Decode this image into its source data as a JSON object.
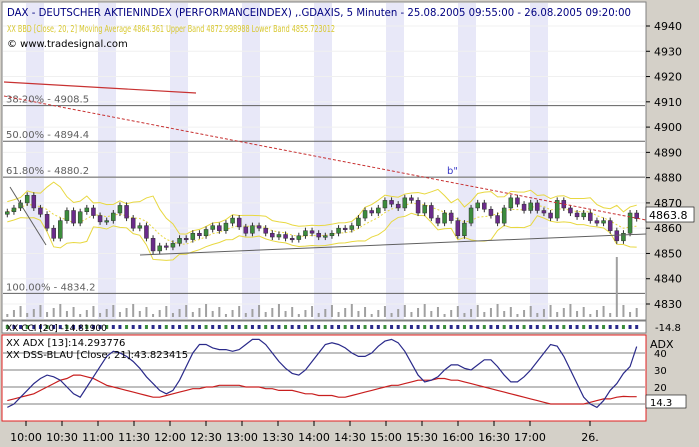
{
  "header": {
    "title": "DAX  - DEUTSCHER AKTIENINDEX (PERFORMANCEINDEX) ,.GDAXIS, 5 Minuten - 25.08.2005 09:55:00 - 26.08.2005 09:20:00",
    "indicator": "XX BBD [Close, 20, 2] Moving Average 4864.361 Upper Band 4872.998988 Lower Band 4855.723012",
    "copyright": "© www.tradesignal.com"
  },
  "fib_levels": [
    {
      "label": "38.20% - 4908.5",
      "value": 4908.5
    },
    {
      "label": "50.00% - 4894.4",
      "value": 4894.4
    },
    {
      "label": "61.80% - 4880.2",
      "value": 4880.2
    },
    {
      "label": "100.00% - 4834.2",
      "value": 4834.2
    }
  ],
  "price_axis": [
    "4940",
    "4930",
    "4920",
    "4910",
    "4900",
    "4890",
    "4880",
    "4870",
    "4860",
    "4850",
    "4840",
    "4830"
  ],
  "last_price": "4863.8",
  "annotation": "b\"",
  "cci_panel": {
    "label": "XX CCI [20] -14.81900",
    "value_label": "-14.8"
  },
  "adx_panel": {
    "label_adx": "XX ADX [13]:14.293776",
    "label_dss": "XX DSS-BLAU [Close, 21]:43.823415",
    "axis_title": "ADX",
    "axis": [
      "40",
      "30",
      "20",
      "10"
    ],
    "last_value": "14.3"
  },
  "time_axis": [
    "10:00",
    "10:30",
    "11:00",
    "11:30",
    "12:00",
    "12:30",
    "13:00",
    "13:30",
    "14:00",
    "14:30",
    "15:00",
    "15:30",
    "16:00",
    "16:30",
    "17:00",
    "26."
  ],
  "colors": {
    "up": "#3c8c3c",
    "down": "#6a2a8a",
    "band": "#e8d840",
    "trend_red": "#c83232",
    "support": "#606060",
    "adx_line": "#c81e1e",
    "dss_line": "#2a2a8a",
    "panel_border": "#e02020"
  },
  "chart_data": {
    "type": "candlestick",
    "title": "DAX  - DEUTSCHER AKTIENINDEX (PERFORMANCEINDEX) ,.GDAXIS, 5 Minuten - 25.08.2005 09:55:00 - 26.08.2005 09:20:00",
    "ylim": [
      4825,
      4945
    ],
    "x": [
      "10:00",
      "10:30",
      "11:00",
      "11:30",
      "12:00",
      "12:30",
      "13:00",
      "13:30",
      "14:00",
      "14:30",
      "15:00",
      "15:30",
      "16:00",
      "16:30",
      "17:00",
      "26."
    ],
    "close": [
      4866.5,
      4868.0,
      4870.0,
      4873.0,
      4868.0,
      4865.5,
      4860.0,
      4856.0,
      4863.0,
      4867.0,
      4862.0,
      4866.5,
      4868.0,
      4865.0,
      4862.5,
      4863.0,
      4866.0,
      4869.0,
      4864.0,
      4860.0,
      4861.0,
      4856.0,
      4851.0,
      4853.0,
      4852.5,
      4854.0,
      4856.0,
      4855.5,
      4858.0,
      4857.0,
      4859.5,
      4861.0,
      4859.0,
      4862.0,
      4864.0,
      4860.5,
      4858.0,
      4861.0,
      4860.0,
      4858.0,
      4856.5,
      4857.5,
      4856.0,
      4855.5,
      4857.0,
      4859.0,
      4858.0,
      4856.5,
      4857.0,
      4858.0,
      4860.0,
      4859.5,
      4861.0,
      4864.0,
      4867.0,
      4866.0,
      4868.0,
      4871.0,
      4869.5,
      4868.0,
      4872.0,
      4871.0,
      4866.0,
      4869.0,
      4864.0,
      4862.0,
      4866.0,
      4863.0,
      4857.0,
      4862.0,
      4868.0,
      4870.0,
      4867.5,
      4865.0,
      4862.0,
      4868.0,
      4872.0,
      4869.5,
      4867.0,
      4870.0,
      4867.0,
      4866.0,
      4864.0,
      4871.0,
      4868.0,
      4866.0,
      4864.5,
      4866.0,
      4863.0,
      4862.0,
      4863.0,
      4859.0,
      4855.0,
      4858.0,
      4866.0,
      4863.8
    ],
    "adx": [
      12,
      13,
      14,
      15,
      16,
      18,
      20,
      22,
      24,
      25,
      27,
      27,
      26,
      25,
      23,
      21,
      20,
      19,
      18,
      17,
      16,
      15,
      14,
      14,
      15,
      16,
      17,
      18,
      19,
      19,
      20,
      20,
      21,
      21,
      21,
      21,
      20,
      20,
      20,
      19,
      19,
      18,
      18,
      18,
      17,
      16,
      16,
      15,
      15,
      15,
      14,
      14,
      15,
      16,
      17,
      18,
      19,
      20,
      21,
      21,
      22,
      23,
      24,
      24,
      24,
      25,
      25,
      24,
      24,
      23,
      22,
      21,
      20,
      19,
      18,
      17,
      16,
      15,
      14,
      13,
      12,
      11,
      10,
      10,
      10,
      10,
      10,
      10,
      11,
      12,
      13,
      13,
      14,
      14.5,
      14.3,
      14.3
    ],
    "dss": [
      8,
      10,
      14,
      18,
      22,
      25,
      27,
      26,
      24,
      20,
      16,
      14,
      20,
      26,
      32,
      38,
      41,
      40,
      38,
      35,
      31,
      26,
      22,
      18,
      16,
      18,
      24,
      32,
      40,
      45,
      45,
      43,
      42,
      42,
      41,
      42,
      45,
      48,
      48,
      45,
      40,
      35,
      31,
      28,
      27,
      30,
      35,
      40,
      45,
      46,
      45,
      43,
      40,
      38,
      38,
      40,
      44,
      47,
      48,
      46,
      41,
      34,
      27,
      23,
      24,
      26,
      30,
      33,
      33,
      31,
      30,
      33,
      36,
      36,
      32,
      27,
      23,
      23,
      26,
      30,
      35,
      40,
      45,
      44,
      38,
      30,
      22,
      14,
      10,
      8,
      12,
      18,
      22,
      28,
      32,
      43.8
    ],
    "adx_ylim": [
      0,
      50
    ]
  }
}
